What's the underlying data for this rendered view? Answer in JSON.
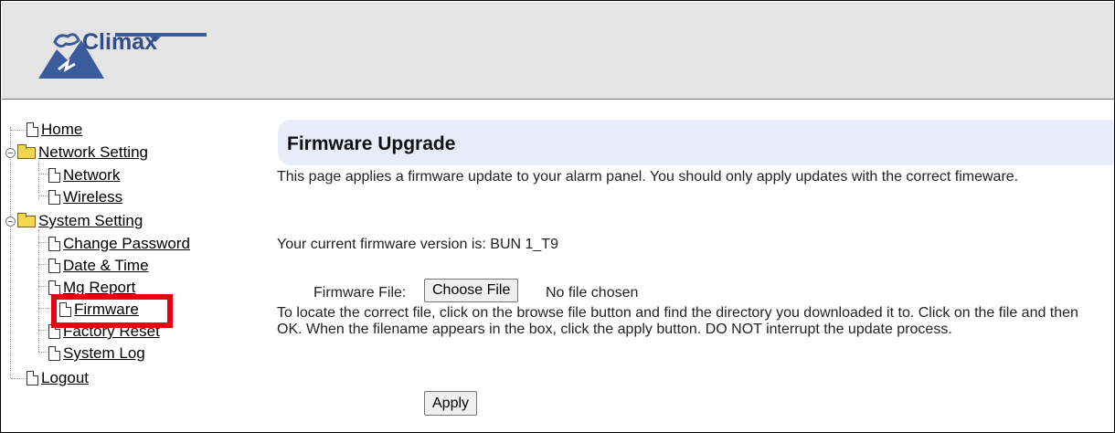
{
  "brand": {
    "name": "Climax"
  },
  "sidebar": {
    "home": "Home",
    "network_setting": "Network Setting",
    "network": "Network",
    "wireless": "Wireless",
    "system_setting": "System Setting",
    "change_password": "Change Password",
    "date_time": "Date & Time",
    "mg_report": "Mg Report",
    "firmware": "Firmware",
    "factory_reset": "Factory Reset",
    "system_log": "System Log",
    "logout": "Logout"
  },
  "main": {
    "title": "Firmware Upgrade",
    "intro": "This page applies a firmware update to your alarm panel. You should only apply updates with the correct fimeware.",
    "current_version": "Your current firmware version is: BUN 1_T9",
    "file_label": "Firmware File:",
    "choose_file": "Choose File",
    "no_file": "No file chosen",
    "instructions": "To locate the correct file, click on the browse file button and find the directory you downloaded it to. Click on the file and then OK. When the filename appears in the box, click the apply button. DO NOT interrupt the update process.",
    "apply": "Apply"
  },
  "colors": {
    "brand_blue": "#2e4f8c",
    "highlight_red": "#e8000e",
    "title_bg": "#e6ecfa"
  }
}
